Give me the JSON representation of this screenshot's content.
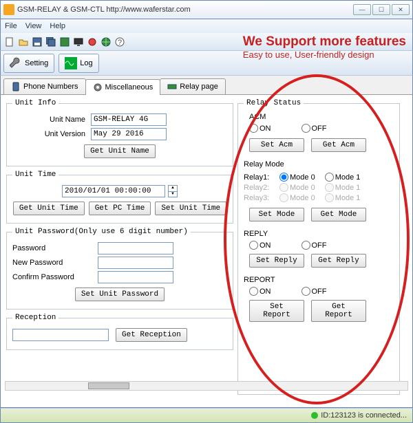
{
  "window": {
    "title": "GSM-RELAY & GSM-CTL     http://www.waferstar.com"
  },
  "menu": {
    "file": "File",
    "view": "View",
    "help": "Help"
  },
  "toolbar": {
    "setting": "Setting",
    "log": "Log"
  },
  "overlay": {
    "line1": "We Support more features",
    "line2": "Easy to use, User-friendly design"
  },
  "tabs": {
    "phone": "Phone Numbers",
    "misc": "Miscellaneous",
    "relay": "Relay page"
  },
  "unitInfo": {
    "legend": "Unit Info",
    "name_lbl": "Unit Name",
    "name_val": "GSM-RELAY 4G",
    "ver_lbl": "Unit Version",
    "ver_val": "May 29 2016",
    "get_btn": "Get Unit Name"
  },
  "unitTime": {
    "legend": "Unit Time",
    "value": "2010/01/01 00:00:00",
    "get_btn": "Get Unit Time",
    "pc_btn": "Get PC Time",
    "set_btn": "Set Unit Time"
  },
  "pwd": {
    "legend": "Unit Password(Only use 6 digit number)",
    "p1": "Password",
    "p2": "New Password",
    "p3": "Confirm Password",
    "set_btn": "Set Unit Password"
  },
  "reception": {
    "legend": "Reception",
    "btn": "Get Reception"
  },
  "relayStatus": {
    "legend": "Relay Status",
    "acm": "ACM",
    "on": "ON",
    "off": "OFF",
    "set_acm": "Set Acm",
    "get_acm": "Get Acm",
    "mode_lbl": "Relay Mode",
    "r1": "Relay1:",
    "r2": "Relay2:",
    "r3": "Relay3:",
    "m0": "Mode 0",
    "m1": "Mode 1",
    "set_mode": "Set Mode",
    "get_mode": "Get Mode",
    "reply": "REPLY",
    "set_reply": "Set Reply",
    "get_reply": "Get Reply",
    "report": "REPORT",
    "set_report": "Set Report",
    "get_report": "Get Report"
  },
  "status": {
    "text": "ID:123123 is connected..."
  }
}
